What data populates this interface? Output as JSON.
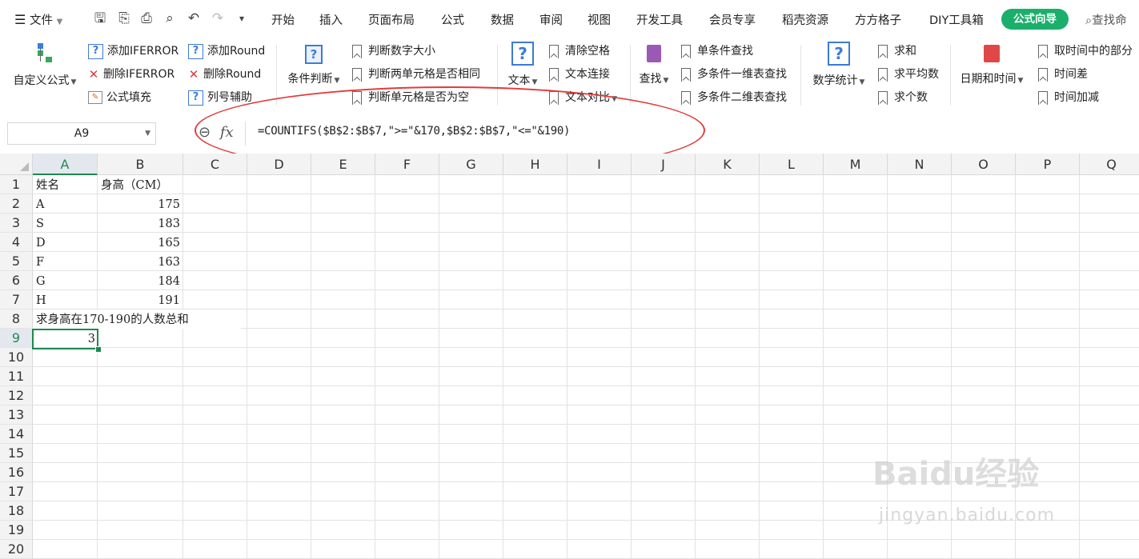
{
  "menu": {
    "file": "文件",
    "tabs": [
      "开始",
      "插入",
      "页面布局",
      "公式",
      "数据",
      "审阅",
      "视图",
      "开发工具",
      "会员专享",
      "稻壳资源",
      "方方格子",
      "DIY工具箱"
    ],
    "active_tab": "公式向导",
    "search": "查找命"
  },
  "ribbon": {
    "custom_formula": "自定义公式",
    "add_iferror": "添加IFERROR",
    "remove_iferror": "删除IFERROR",
    "formula_fill": "公式填充",
    "add_round": "添加Round",
    "remove_round": "删除Round",
    "col_helper": "列号辅助",
    "condition": "条件判断",
    "judge_num_size": "判断数字大小",
    "judge_two_cells": "判断两单元格是否相同",
    "judge_cell_empty": "判断单元格是否为空",
    "text": "文本",
    "clear_space": "清除空格",
    "text_join": "文本连接",
    "text_compare": "文本对比",
    "lookup": "查找",
    "single_lookup": "单条件查找",
    "multi_1d_lookup": "多条件一维表查找",
    "multi_2d_lookup": "多条件二维表查找",
    "stats": "数学统计",
    "sum": "求和",
    "avg": "求平均数",
    "count": "求个数",
    "datetime": "日期和时间",
    "time_part": "取时间中的部分",
    "time_diff": "时间差",
    "time_add": "时间加减"
  },
  "formula_bar": {
    "cell_ref": "A9",
    "fx": "fx",
    "formula": "=COUNTIFS($B$2:$B$7,\">=\"&170,$B$2:$B$7,\"<=\"&190)"
  },
  "sheet": {
    "columns": [
      "A",
      "B",
      "C",
      "D",
      "E",
      "F",
      "G",
      "H",
      "I",
      "J",
      "K",
      "L",
      "M",
      "N",
      "O",
      "P",
      "Q"
    ],
    "rows": [
      "1",
      "2",
      "3",
      "4",
      "5",
      "6",
      "7",
      "8",
      "9",
      "10",
      "11",
      "12",
      "13",
      "14",
      "15",
      "16",
      "17",
      "18",
      "19",
      "20"
    ],
    "header": {
      "name": "姓名",
      "height": "身高（CM）"
    },
    "data": [
      {
        "name": "A",
        "height": "175"
      },
      {
        "name": "S",
        "height": "183"
      },
      {
        "name": "D",
        "height": "165"
      },
      {
        "name": "F",
        "height": "163"
      },
      {
        "name": "G",
        "height": "184"
      },
      {
        "name": "H",
        "height": "191"
      }
    ],
    "note": "求身高在170-190的人数总和",
    "result": "3"
  },
  "watermark": {
    "brand": "Baidu经验",
    "url": "jingyan.baidu.com"
  }
}
